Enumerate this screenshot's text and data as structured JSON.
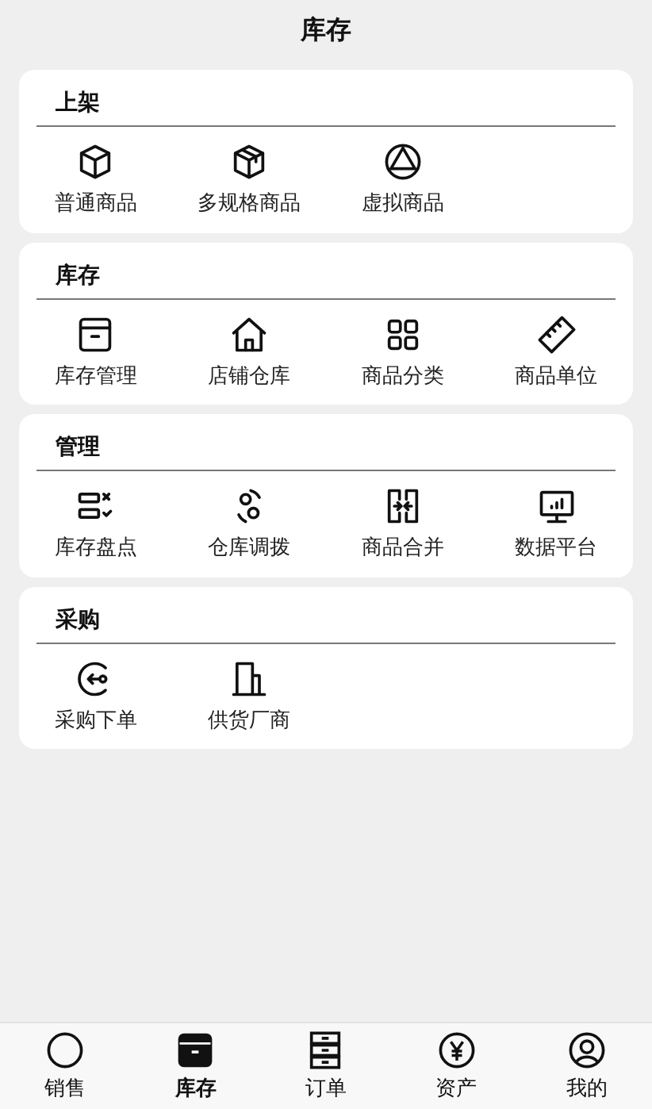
{
  "header": {
    "title": "库存"
  },
  "sections": [
    {
      "title": "上架",
      "items": [
        {
          "label": "普通商品"
        },
        {
          "label": "多规格商品"
        },
        {
          "label": "虚拟商品"
        }
      ]
    },
    {
      "title": "库存",
      "items": [
        {
          "label": "库存管理"
        },
        {
          "label": "店铺仓库"
        },
        {
          "label": "商品分类"
        },
        {
          "label": "商品单位"
        }
      ]
    },
    {
      "title": "管理",
      "items": [
        {
          "label": "库存盘点"
        },
        {
          "label": "仓库调拨"
        },
        {
          "label": "商品合并"
        },
        {
          "label": "数据平台"
        }
      ]
    },
    {
      "title": "采购",
      "items": [
        {
          "label": "采购下单"
        },
        {
          "label": "供货厂商"
        }
      ]
    }
  ],
  "tab_bar": [
    {
      "label": "销售",
      "selected": false
    },
    {
      "label": "库存",
      "selected": true
    },
    {
      "label": "订单",
      "selected": false
    },
    {
      "label": "资产",
      "selected": false
    },
    {
      "label": "我的",
      "selected": false
    }
  ]
}
